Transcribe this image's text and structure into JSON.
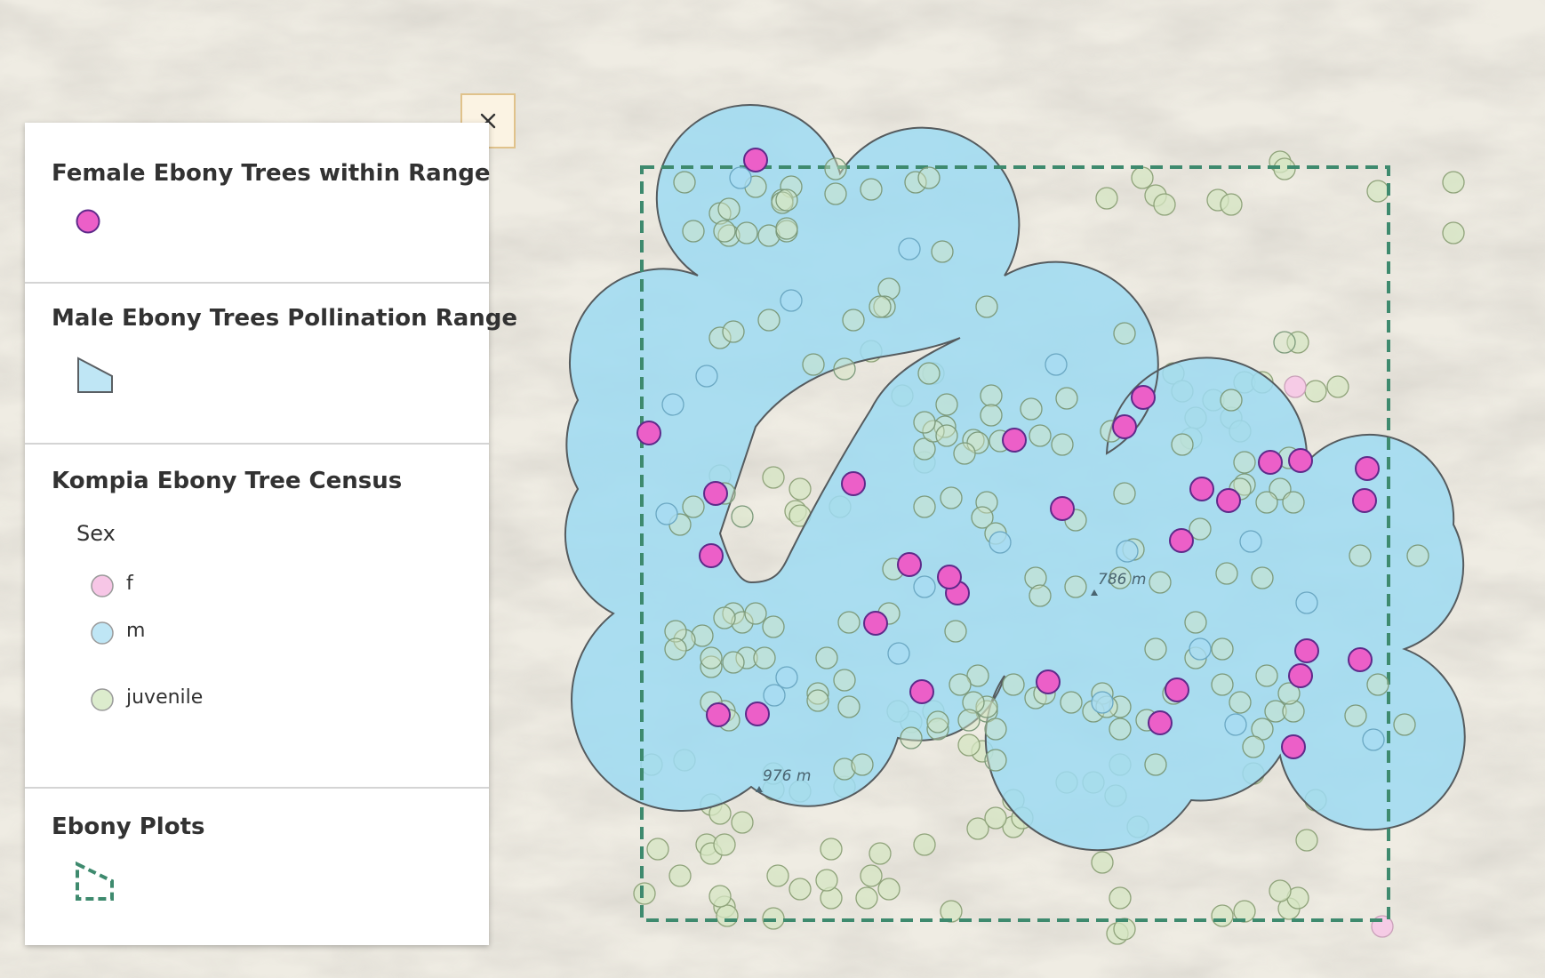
{
  "legend": {
    "sections": [
      {
        "title": "Female Ebony Trees within Range"
      },
      {
        "title": "Male Ebony Trees Pollination Range"
      },
      {
        "title": "Kompia Ebony Tree Census",
        "field": "Sex",
        "items": [
          {
            "label": "f",
            "color": "#f7c6e6"
          },
          {
            "label": "m",
            "color": "#bfe6f5"
          },
          {
            "label": "juvenile",
            "color": "#dceccd"
          }
        ]
      },
      {
        "title": "Ebony Plots"
      }
    ]
  },
  "close_button": {
    "icon": "close-icon"
  },
  "map": {
    "elevation_labels": [
      "786 m",
      "976 m"
    ],
    "colors": {
      "female_in_range": "#ec5fc8",
      "pollination_range": "#9edbf2",
      "plot_outline": "#3e8a6e",
      "census_f": "#f7c6e6",
      "census_m": "#a8dcf2",
      "census_juvenile": "#d5e6c3"
    }
  }
}
